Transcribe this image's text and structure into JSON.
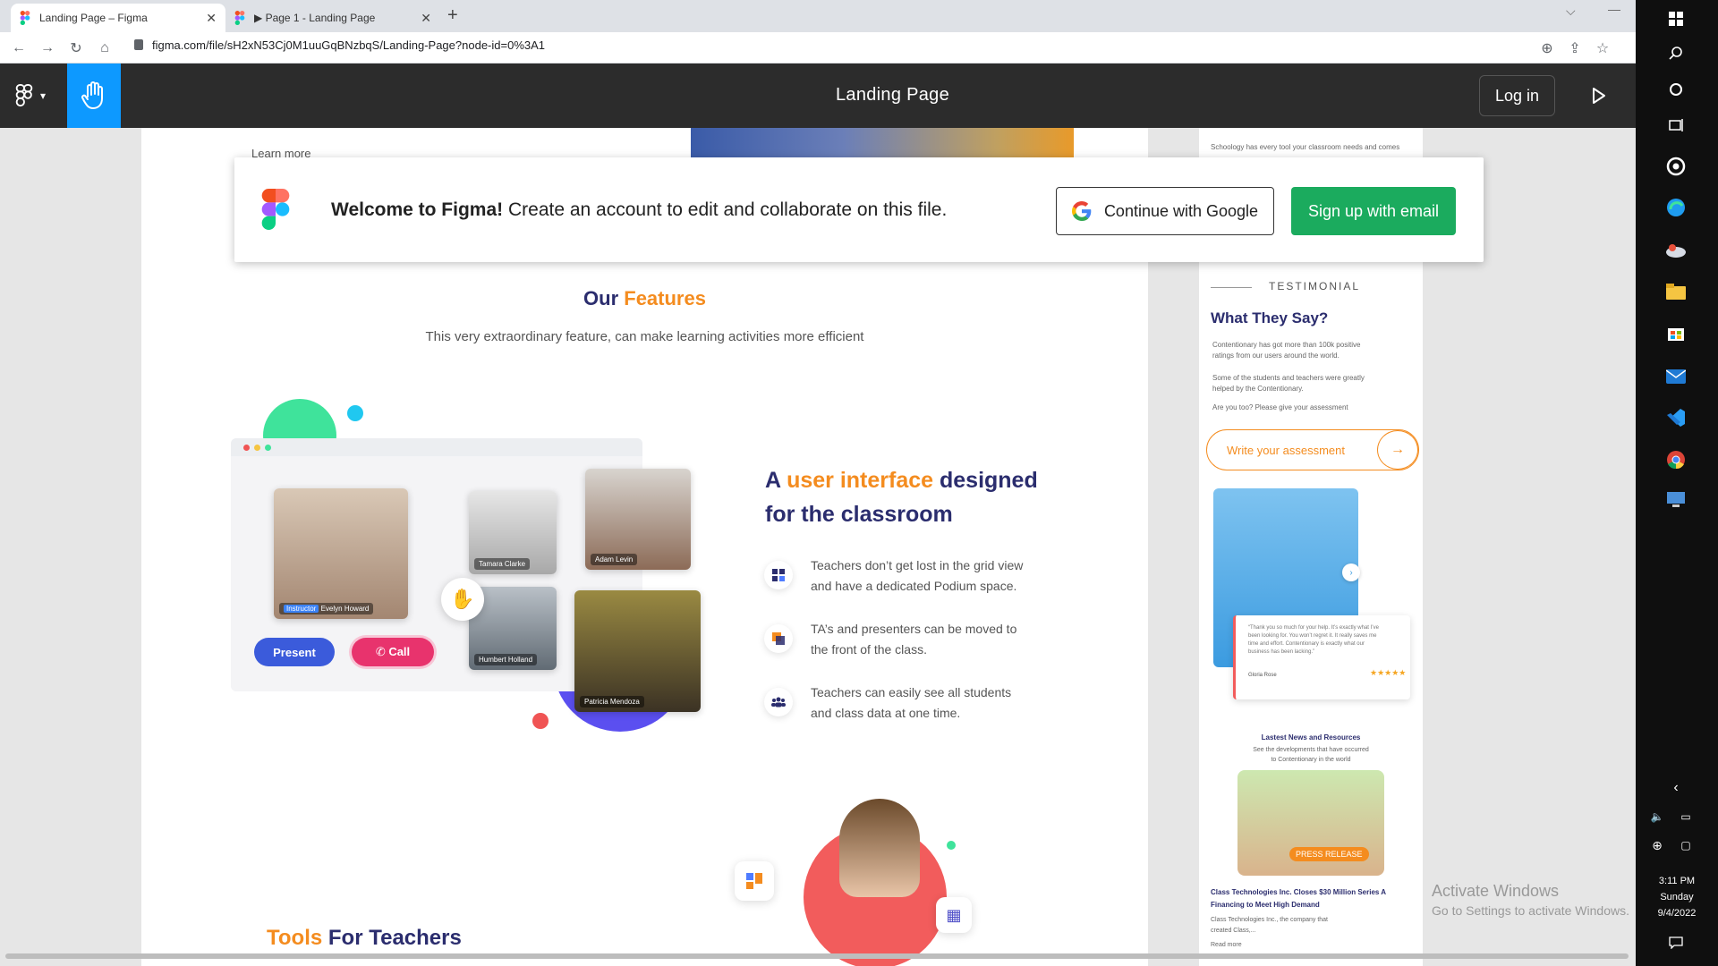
{
  "browser": {
    "tabs": [
      {
        "label": "Landing Page – Figma",
        "active": true
      },
      {
        "label": "▶ Page 1 - Landing Page",
        "active": false
      }
    ],
    "new_tab": "+",
    "url": "figma.com/file/sH2xN53Cj0M1uuGqBNzbqS/Landing-Page?node-id=0%3A1",
    "back": "←",
    "forward": "→",
    "reload": "↻",
    "home": "⌂",
    "zoom_icon": "⊕",
    "share_icon": "⇪",
    "star_icon": "☆"
  },
  "figma": {
    "file_title": "Landing Page",
    "login": "Log in",
    "main_menu": "☰",
    "tool": "hand"
  },
  "banner": {
    "welcome_bold": "Welcome to Figma!",
    "welcome_rest": " Create an account to edit and collaborate on this file.",
    "google": "Continue with Google",
    "email": "Sign up with email"
  },
  "landing": {
    "learn_more": "Learn more",
    "features_title_1": "Our ",
    "features_title_2": "Features",
    "features_sub": "This very extraordinary feature, can make learning activities more efficient",
    "present": "Present",
    "call": "✆ Call",
    "names": {
      "instructor_tag": "Instructor",
      "instructor": "Evelyn Howard",
      "p2": "Tamara Clarke",
      "p3": "Adam Levin",
      "p4": "Humbert Holland",
      "p5": "Patricia Mendoza"
    },
    "ui_heading_1": "A ",
    "ui_heading_2": "user interface",
    "ui_heading_3": " designed",
    "ui_heading_4": "for the classroom",
    "features": [
      {
        "line1": "Teachers don’t get lost in the grid view",
        "line2": "and have a dedicated Podium space."
      },
      {
        "line1": "TA’s and presenters can be moved to",
        "line2": "the front of the class."
      },
      {
        "line1": "Teachers can easily see all students",
        "line2": "and class data at one time."
      }
    ],
    "tools_title_1": "Tools",
    "tools_title_2": " For Teachers"
  },
  "right_frame": {
    "top_text": "Schoology has every tool your classroom needs and comes",
    "testimonial_label": "TESTIMONIAL",
    "testimonial_title": "What They Say?",
    "t1_l1": "Contentionary has got more than 100k positive",
    "t1_l2": "ratings from our users around the world.",
    "t2_l1": "Some of the students and teachers were greatly",
    "t2_l2": "helped by the Contentionary.",
    "t3": "Are you too? Please give your assessment",
    "write": "Write your assessment",
    "arrow": "→",
    "quote_l1": "“Thank you so much for your help. It’s exactly what I’ve",
    "quote_l2": "been looking for. You won’t regret it. It really saves me",
    "quote_l3": "time and effort. Contentionary is exactly what our",
    "quote_l4": "business has been lacking.”",
    "quote_author": "Gloria Rose",
    "stars": "★★★★★",
    "news_title": "Lastest News and Resources",
    "news_sub_1": "See the developments that have occurred",
    "news_sub_2": "to Contentionary in the world",
    "press": "PRESS RELEASE",
    "news_head_1": "Class Technologies Inc. Closes $30 Million Series A",
    "news_head_2": "Financing to Meet High Demand",
    "news_body_1": "Class Technologies Inc., the company that",
    "news_body_2": "created Class,...",
    "read_more": "Read more"
  },
  "os": {
    "activate_1": "Activate Windows",
    "activate_2": "Go to Settings to activate Windows.",
    "time": "3:11 PM",
    "day": "Sunday",
    "date": "9/4/2022"
  },
  "colors": {
    "figma_bar": "#2c2c2c",
    "hand_tool": "#0d99ff",
    "signup_green": "#1bab5e",
    "navy": "#2b2d6e",
    "orange": "#f48c1f"
  }
}
